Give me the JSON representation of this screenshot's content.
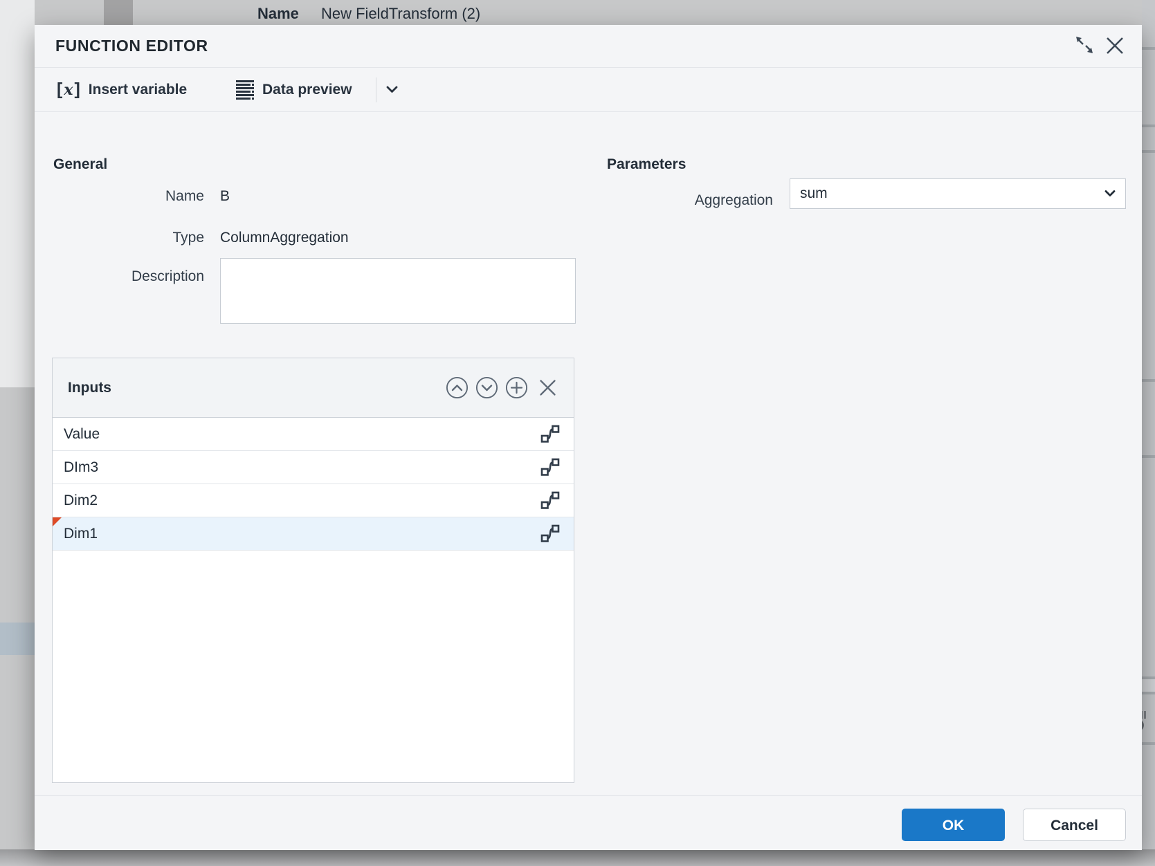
{
  "backdrop": {
    "caption_label": "Name",
    "caption_value": "New FieldTransform (2)"
  },
  "modal": {
    "title": "FUNCTION EDITOR",
    "toolbar": {
      "insert_variable_label": "Insert variable",
      "data_preview_label": "Data preview"
    },
    "general": {
      "heading": "General",
      "name_label": "Name",
      "name_value": "B",
      "type_label": "Type",
      "type_value": "ColumnAggregation",
      "description_label": "Description",
      "description_value": ""
    },
    "inputs": {
      "heading": "Inputs",
      "rows": [
        {
          "label": "Value",
          "selected": false
        },
        {
          "label": "DIm3",
          "selected": false
        },
        {
          "label": "Dim2",
          "selected": false
        },
        {
          "label": "Dim1",
          "selected": true
        }
      ]
    },
    "parameters": {
      "heading": "Parameters",
      "aggregation_label": "Aggregation",
      "aggregation_value": "sum"
    },
    "footer": {
      "ok_label": "OK",
      "cancel_label": "Cancel"
    }
  },
  "icons": {
    "insert_variable_bracket_open": "[",
    "insert_variable_x": "x",
    "insert_variable_bracket_close": "]",
    "grid_plus": "+"
  },
  "colors": {
    "accent_blue": "#1a78c8",
    "modal_bg": "#f4f5f7",
    "selected_row_bg": "#e9f3fc",
    "dirty_marker_red": "#dd4b27",
    "text_dark": "#232d38",
    "icon_gray": "#5f6a77",
    "border_gray": "#c6ccd3",
    "backdrop_gray": "#c7c8c9"
  }
}
